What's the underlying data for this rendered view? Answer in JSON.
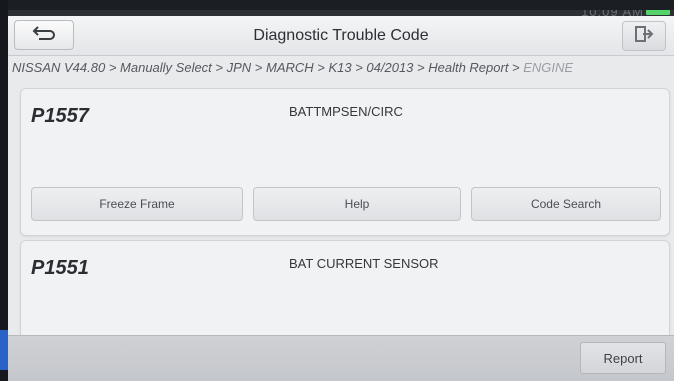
{
  "status_bar": {
    "text": "10:09 AM",
    "battery_color": "#55d36b"
  },
  "titlebar": {
    "title": "Diagnostic Trouble Code",
    "back_icon": "back-arrow-icon",
    "exit_icon": "exit-icon"
  },
  "breadcrumb": {
    "path": "NISSAN V44.80 > Manually Select > JPN > MARCH > K13 > 04/2013 > Health Report > ",
    "last": "ENGINE"
  },
  "dtc_list": [
    {
      "code": "P1557",
      "description": "BATTMPSEN/CIRC",
      "buttons": [
        "Freeze Frame",
        "Help",
        "Code Search"
      ]
    },
    {
      "code": "P1551",
      "description": "BAT CURRENT SENSOR"
    }
  ],
  "footer": {
    "report_label": "Report"
  }
}
